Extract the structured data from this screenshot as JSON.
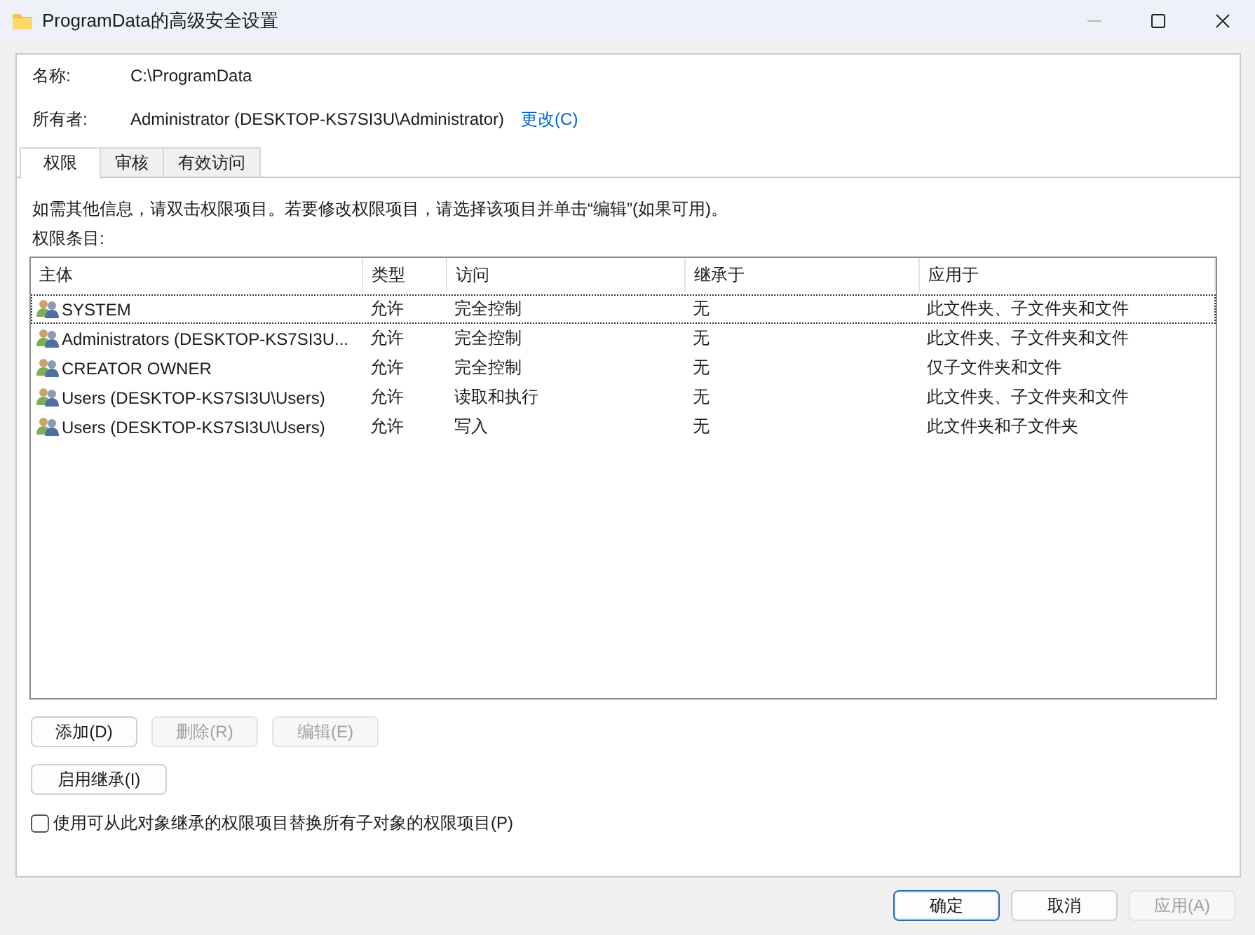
{
  "window": {
    "title": "ProgramData的高级安全设置",
    "controls": [
      {
        "kind": "minimize",
        "disabled": true
      },
      {
        "kind": "maximize",
        "disabled": false
      },
      {
        "kind": "close",
        "disabled": false
      }
    ]
  },
  "name": {
    "label": "名称:",
    "value": "C:\\ProgramData"
  },
  "owner": {
    "label": "所有者:",
    "value": "Administrator (DESKTOP-KS7SI3U\\Administrator)",
    "link": "更改(C)"
  },
  "tabs": [
    {
      "label": "权限",
      "selected": true
    },
    {
      "label": "审核",
      "selected": false
    },
    {
      "label": "有效访问",
      "selected": false
    }
  ],
  "info_text": "如需其他信息，请双击权限项目。若要修改权限项目，请选择该项目并单击“编辑”(如果可用)。",
  "list_label": "权限条目:",
  "table": {
    "columns": [
      "主体",
      "类型",
      "访问",
      "继承于",
      "应用于"
    ],
    "rows": [
      {
        "cells": [
          "SYSTEM",
          "允许",
          "完全控制",
          "无",
          "此文件夹、子文件夹和文件"
        ],
        "focused": true
      },
      {
        "cells": [
          "Administrators (DESKTOP-KS7SI3U...",
          "允许",
          "完全控制",
          "无",
          "此文件夹、子文件夹和文件"
        ],
        "focused": false
      },
      {
        "cells": [
          "CREATOR OWNER",
          "允许",
          "完全控制",
          "无",
          "仅子文件夹和文件"
        ],
        "focused": false
      },
      {
        "cells": [
          "Users (DESKTOP-KS7SI3U\\Users)",
          "允许",
          "读取和执行",
          "无",
          "此文件夹、子文件夹和文件"
        ],
        "focused": false
      },
      {
        "cells": [
          "Users (DESKTOP-KS7SI3U\\Users)",
          "允许",
          "写入",
          "无",
          "此文件夹和子文件夹"
        ],
        "focused": false
      }
    ]
  },
  "buttons": [
    {
      "label": "添加(D)",
      "disabled": false
    },
    {
      "label": "删除(R)",
      "disabled": true
    },
    {
      "label": "编辑(E)",
      "disabled": true
    }
  ],
  "inherit_button": {
    "label": "启用继承(I)",
    "disabled": false
  },
  "replace_checkbox": {
    "label": "使用可从此对象继承的权限项目替换所有子对象的权限项目(P)",
    "checked": false
  },
  "footer_buttons": [
    {
      "label": "确定",
      "disabled": false,
      "default": true
    },
    {
      "label": "取消",
      "disabled": false,
      "default": false
    },
    {
      "label": "应用(A)",
      "disabled": true,
      "default": false
    }
  ]
}
